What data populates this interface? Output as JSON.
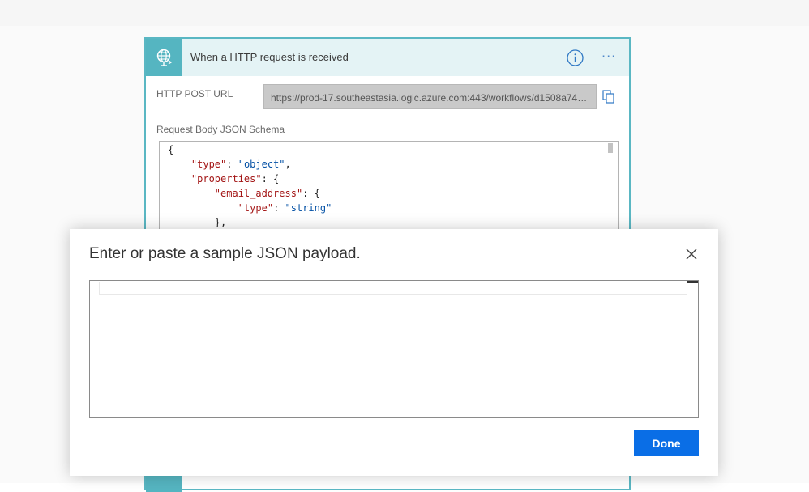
{
  "trigger": {
    "title": "When a HTTP request is received",
    "url_label": "HTTP POST URL",
    "url_value": "https://prod-17.southeastasia.logic.azure.com:443/workflows/d1508a74a...",
    "schema_label": "Request Body JSON Schema",
    "schema_lines": [
      {
        "indent": "",
        "parts": [
          {
            "t": "{",
            "c": "punct"
          }
        ]
      },
      {
        "indent": "    ",
        "parts": [
          {
            "t": "\"type\"",
            "c": "str-key"
          },
          {
            "t": ": ",
            "c": "punct"
          },
          {
            "t": "\"object\"",
            "c": "str-val"
          },
          {
            "t": ",",
            "c": "punct"
          }
        ]
      },
      {
        "indent": "    ",
        "parts": [
          {
            "t": "\"properties\"",
            "c": "str-key"
          },
          {
            "t": ": {",
            "c": "punct"
          }
        ]
      },
      {
        "indent": "        ",
        "parts": [
          {
            "t": "\"email_address\"",
            "c": "str-key"
          },
          {
            "t": ": {",
            "c": "punct"
          }
        ]
      },
      {
        "indent": "            ",
        "parts": [
          {
            "t": "\"type\"",
            "c": "str-key"
          },
          {
            "t": ": ",
            "c": "punct"
          },
          {
            "t": "\"string\"",
            "c": "str-val"
          }
        ]
      },
      {
        "indent": "        ",
        "parts": [
          {
            "t": "},",
            "c": "punct"
          }
        ]
      }
    ],
    "icons": {
      "connector": "http-request-globe-icon",
      "info": "info-icon",
      "more": "more-options-icon",
      "copy": "copy-icon"
    }
  },
  "modal": {
    "title": "Enter or paste a sample JSON payload.",
    "payload_value": "",
    "done_label": "Done",
    "close_icon": "close-icon"
  },
  "colors": {
    "accent": "#55b5c1",
    "header_bg": "#e4f3f5",
    "primary_button": "#0a6ee6",
    "json_key": "#a31515",
    "json_value": "#0451a5"
  }
}
